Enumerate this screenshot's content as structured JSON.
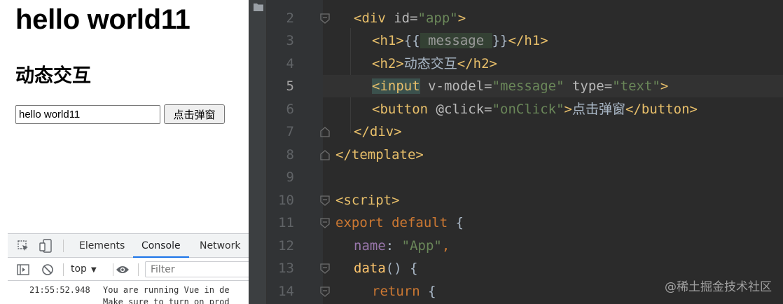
{
  "preview": {
    "heading": "hello world11",
    "subheading": "动态交互",
    "input_value": "hello world11",
    "button_label": "点击弹窗"
  },
  "devtools": {
    "icons": [
      "inspect-element-icon",
      "device-toolbar-icon"
    ],
    "tabs": [
      {
        "label": "Elements",
        "active": false
      },
      {
        "label": "Console",
        "active": true
      },
      {
        "label": "Network",
        "active": false
      }
    ],
    "toolbar_icons": [
      "sidebar-toggle-icon",
      "clear-console-icon",
      "eye-icon"
    ],
    "context": "top",
    "filter_placeholder": "Filter",
    "log": {
      "time": "21:55:52.948",
      "line1": "You are running Vue in de",
      "line2": "Make sure to turn on prod"
    }
  },
  "editor": {
    "current_line": 5,
    "lines": [
      {
        "n": "2"
      },
      {
        "n": "3"
      },
      {
        "n": "4"
      },
      {
        "n": "5"
      },
      {
        "n": "6"
      },
      {
        "n": "7"
      },
      {
        "n": "8"
      },
      {
        "n": "9"
      },
      {
        "n": "10"
      },
      {
        "n": "11"
      },
      {
        "n": "12"
      },
      {
        "n": "13"
      },
      {
        "n": "14"
      }
    ],
    "code": {
      "l2_open": "<div ",
      "l2_attr": "id=",
      "l2_val": "\"app\"",
      "l2_close": ">",
      "l3_open": "<h1>",
      "l3_lbrace": "{{",
      "l3_var": " message ",
      "l3_rbrace": "}}",
      "l3_close": "</h1>",
      "l4_open": "<h2>",
      "l4_text": "动态交互",
      "l4_close": "</h2>",
      "l5_open": "<input",
      "l5_attr1": " v-model=",
      "l5_val1": "\"message\"",
      "l5_attr2": " type=",
      "l5_val2": "\"text\"",
      "l5_close": ">",
      "l6_open": "<button ",
      "l6_attr": "@click=",
      "l6_val": "\"onClick\"",
      "l6_gt": ">",
      "l6_text": "点击弹窗",
      "l6_close": "</button>",
      "l7": "</div>",
      "l8": "</template>",
      "l10": "<script>",
      "l11_kw1": "export",
      "l11_kw2": " default",
      "l11_brace": " {",
      "l12_prop": "name",
      "l12_colon": ": ",
      "l12_str": "\"App\"",
      "l12_comma": ",",
      "l13_fn": "data",
      "l13_rest": "() {",
      "l14_kw": "return",
      "l14_brace": " {"
    }
  },
  "watermark": "@稀土掘金技术社区"
}
